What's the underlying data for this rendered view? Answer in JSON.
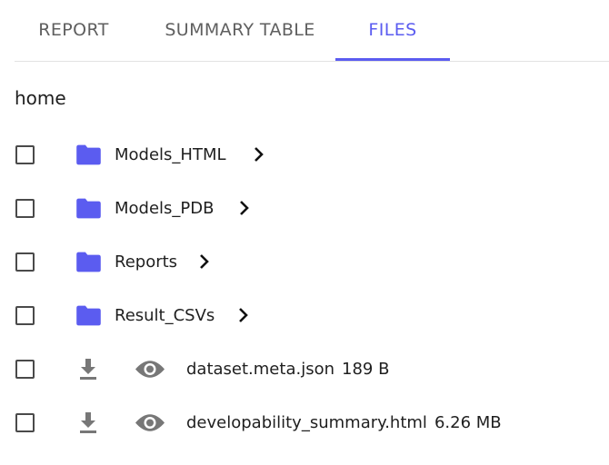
{
  "tabs": [
    {
      "label": "REPORT"
    },
    {
      "label": "SUMMARY TABLE"
    },
    {
      "label": "FILES"
    }
  ],
  "active_tab": "FILES",
  "breadcrumb": "home",
  "folders": [
    {
      "name": "Models_HTML"
    },
    {
      "name": "Models_PDB"
    },
    {
      "name": "Reports"
    },
    {
      "name": "Result_CSVs"
    }
  ],
  "files": [
    {
      "name": "dataset.meta.json",
      "size": "189 B"
    },
    {
      "name": "developability_summary.html",
      "size": "6.26 MB"
    }
  ],
  "icons": {
    "folder": "folder-icon",
    "chevron": "chevron-right-icon",
    "download": "download-icon",
    "preview": "eye-icon"
  },
  "colors": {
    "accent": "#5b5cf0",
    "folder": "#5b5cf0",
    "icon_gray": "#777777"
  }
}
